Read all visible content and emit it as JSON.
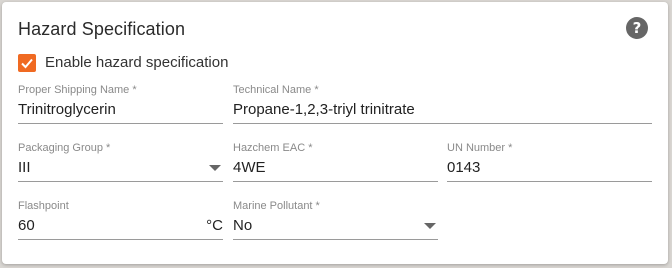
{
  "panel": {
    "title": "Hazard Specification",
    "help_symbol": "?"
  },
  "enable_checkbox": {
    "label": "Enable hazard specification",
    "checked": true,
    "color": "#f06a22"
  },
  "fields": {
    "proper_shipping_name": {
      "label": "Proper Shipping Name *",
      "value": "Trinitroglycerin"
    },
    "technical_name": {
      "label": "Technical Name *",
      "value": "Propane-1,2,3-triyl trinitrate"
    },
    "packaging_group": {
      "label": "Packaging Group *",
      "value": "III"
    },
    "hazchem_eac": {
      "label": "Hazchem EAC *",
      "value": "4WE"
    },
    "un_number": {
      "label": "UN Number *",
      "value": "0143"
    },
    "flashpoint": {
      "label": "Flashpoint",
      "value": "60",
      "unit": "°C"
    },
    "marine_pollutant": {
      "label": "Marine Pollutant *",
      "value": "No"
    }
  },
  "icons": {
    "help": "help-circle-icon",
    "check": "check-icon",
    "dropdown": "chevron-down-icon"
  }
}
